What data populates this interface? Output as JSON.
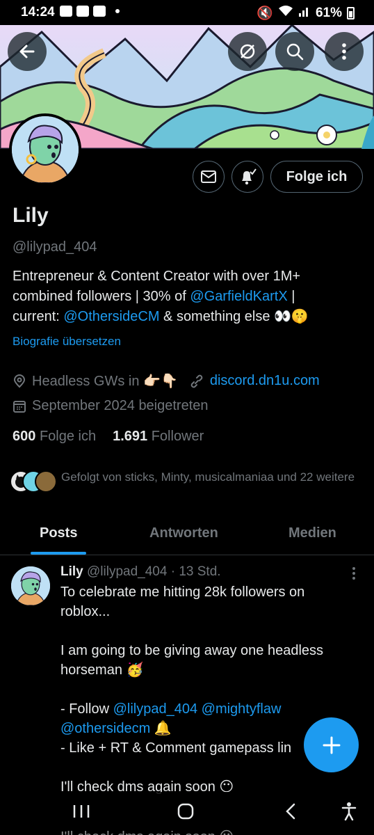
{
  "status_bar": {
    "time": "14:24",
    "battery": "61%"
  },
  "profile": {
    "name": "Lily",
    "handle": "@lilypad_404",
    "bio": {
      "line1": "Entrepreneur & Content Creator with over 1M+",
      "line2_pre": "combined followers | 30% of ",
      "line2_link": "@GarfieldKartX",
      "line2_post": " |",
      "line3_pre": "current: ",
      "line3_link": "@OthersideCM",
      "line3_post": " & something else 👀🤫"
    },
    "translate_label": "Biografie übersetzen",
    "location": "Headless GWs in 👉🏻👇🏻",
    "website": "discord.dn1u.com",
    "joined": "September 2024 beigetreten",
    "following_count": "600",
    "following_label": "Folge ich",
    "followers_count": "1.691",
    "followers_label": "Follower",
    "followed_by": "Gefolgt von sticks, Minty, musicalmaniaa und 22 weitere"
  },
  "actions": {
    "follow_label": "Folge ich"
  },
  "tabs": [
    {
      "label": "Posts"
    },
    {
      "label": "Antworten"
    },
    {
      "label": "Medien"
    }
  ],
  "post": {
    "author": "Lily",
    "handle": "@lilypad_404",
    "time": "· 13 Std.",
    "line1": "To celebrate me hitting 28k followers on",
    "line2": "roblox...",
    "line3": "I am going to be giving away one headless",
    "line4": "horseman 🥳",
    "line5_pre": "- Follow ",
    "line5_link1": "@lilypad_404",
    "line5_link2": "@mightyflaw",
    "line6_link": "@othersidecm",
    "line6_post": " 🔔",
    "line7": "- Like + RT & Comment gamepass lin",
    "line8": "I'll check dms again soon 😶",
    "line9": "I'll check dms again soon 😶"
  },
  "colors": {
    "accent": "#1d9bf0",
    "background": "#000000",
    "text_primary": "#e7e9ea",
    "text_secondary": "#71767b"
  }
}
